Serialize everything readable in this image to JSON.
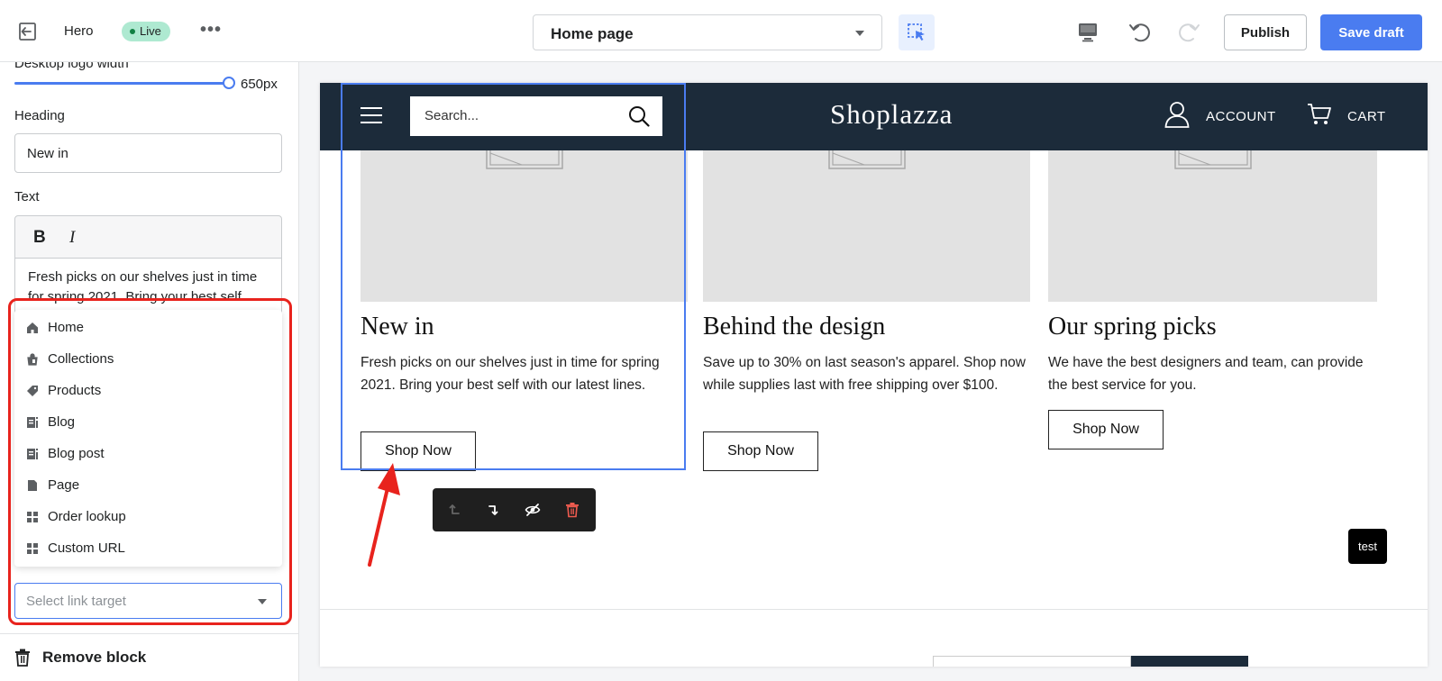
{
  "topbar": {
    "section_title": "Hero",
    "status_badge": "Live",
    "more_label": "•••",
    "page_selector": "Home page",
    "publish_label": "Publish",
    "save_label": "Save draft"
  },
  "left_panel": {
    "logo_width_label": "Desktop logo width",
    "logo_width_value": "650px",
    "heading_label": "Heading",
    "heading_value": "New in",
    "text_label": "Text",
    "bold_label": "B",
    "italic_label": "I",
    "text_value": "Fresh picks on our shelves just in time for spring 2021. Bring your best self with our latest lines.",
    "link_options": [
      {
        "label": "Home",
        "icon": "home-icon"
      },
      {
        "label": "Collections",
        "icon": "collections-icon"
      },
      {
        "label": "Products",
        "icon": "tag-icon"
      },
      {
        "label": "Blog",
        "icon": "blog-icon"
      },
      {
        "label": "Blog post",
        "icon": "blog-post-icon"
      },
      {
        "label": "Page",
        "icon": "page-icon"
      },
      {
        "label": "Order lookup",
        "icon": "grid-icon"
      },
      {
        "label": "Custom URL",
        "icon": "grid-icon"
      }
    ],
    "link_target_placeholder": "Select link target",
    "remove_block_label": "Remove block"
  },
  "preview": {
    "search_placeholder": "Search...",
    "store_logo": "Shoplazza",
    "account_label": "ACCOUNT",
    "cart_label": "CART",
    "cards": [
      {
        "title": "New in",
        "text": "Fresh picks on our shelves just in time for spring 2021. Bring your best self with our latest lines.",
        "button": "Shop Now"
      },
      {
        "title": "Behind the design",
        "text": "Save up to 30% on last season's apparel. Shop now while supplies last with free shipping over $100.",
        "button": "Shop Now"
      },
      {
        "title": "Our spring picks",
        "text": "We have the best designers and team, can provide the best service for you.",
        "button": "Shop Now"
      }
    ],
    "test_badge": "test"
  },
  "colors": {
    "accent": "#4a7cf0",
    "header_bg": "#1c2b3a",
    "live_badge": "#aee9d1",
    "annotation_red": "#e8231d"
  }
}
